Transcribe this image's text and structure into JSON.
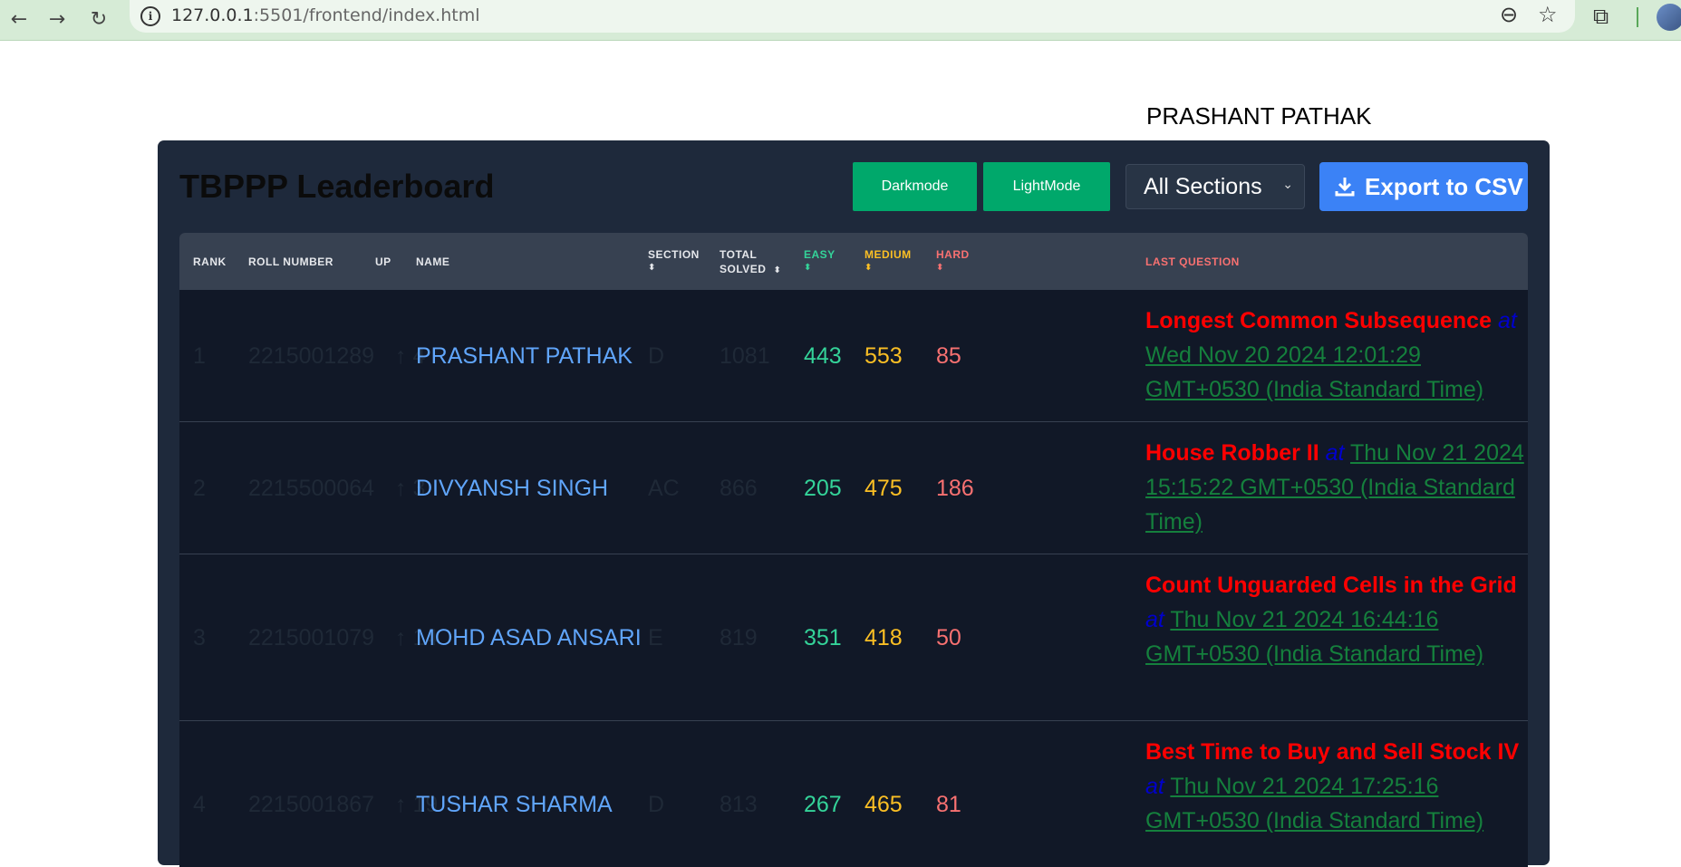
{
  "browser": {
    "url_host": "127.0.0.1",
    "url_rest": ":5501/frontend/index.html"
  },
  "top_user": "PRASHANT PATHAK",
  "header": {
    "title": "TBPPP Leaderboard",
    "darkmode_label": "Darkmode",
    "lightmode_label": "LightMode",
    "section_select_value": "All Sections",
    "export_label": "Export to CSV"
  },
  "columns": {
    "rank": "RANK",
    "roll": "ROLL NUMBER",
    "up": "UP",
    "name": "NAME",
    "section": "SECTION",
    "total_1": "TOTAL",
    "total_2": "SOLVED",
    "easy": "EASY",
    "medium": "MEDIUM",
    "hard": "HARD",
    "last": "LAST QUESTION"
  },
  "rows": [
    {
      "rank": "1",
      "roll": "2215001289",
      "up": "↑ 4",
      "name": "PRASHANT PATHAK",
      "section": "D",
      "total": "1081",
      "easy": "443",
      "medium": "553",
      "hard": "85",
      "q_title": "Longest Common Subsequence",
      "q_at": "at",
      "q_time": "Wed Nov 20 2024 12:01:29 GMT+0530 (India Standard Time)"
    },
    {
      "rank": "2",
      "roll": "2215500064",
      "up": "↑ 3",
      "name": "DIVYANSH SINGH",
      "section": "AC",
      "total": "866",
      "easy": "205",
      "medium": "475",
      "hard": "186",
      "q_title": "House Robber II",
      "q_at": "at",
      "q_time": "Thu Nov 21 2024 15:15:22 GMT+0530 (India Standard Time)"
    },
    {
      "rank": "3",
      "roll": "2215001079",
      "up": "↑ 14",
      "name": "MOHD ASAD ANSARI",
      "section": "E",
      "total": "819",
      "easy": "351",
      "medium": "418",
      "hard": "50",
      "q_title": "Count Unguarded Cells in the Grid",
      "q_at": "at",
      "q_time": "Thu Nov 21 2024 16:44:16 GMT+0530 (India Standard Time)"
    },
    {
      "rank": "4",
      "roll": "2215001867",
      "up": "↑ 19",
      "name": "TUSHAR SHARMA",
      "section": "D",
      "total": "813",
      "easy": "267",
      "medium": "465",
      "hard": "81",
      "q_title": "Best Time to Buy and Sell Stock IV",
      "q_at": "at",
      "q_time": "Thu Nov 21 2024 17:25:16 GMT+0530 (India Standard Time)"
    }
  ]
}
